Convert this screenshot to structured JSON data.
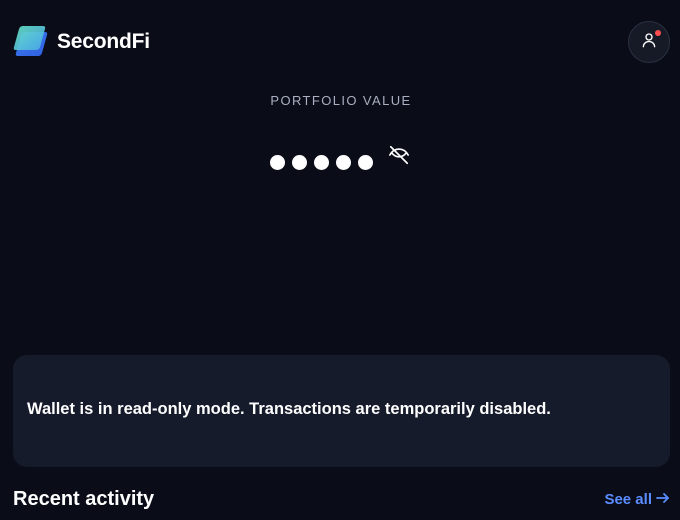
{
  "header": {
    "brand": "SecondFi",
    "logo_icon": "layers-logo-icon",
    "profile_icon": "user-icon",
    "has_notification": true
  },
  "portfolio": {
    "label": "PORTFOLIO VALUE",
    "masked_dots": 5,
    "visibility_icon": "eye-off-icon"
  },
  "banner": {
    "message": "Wallet is in read-only mode. Transactions are temporarily disabled."
  },
  "recent_activity": {
    "title": "Recent activity",
    "see_all_label": "See all",
    "see_all_icon": "arrow-right-icon"
  },
  "colors": {
    "background": "#0a0d18",
    "card": "#161b2b",
    "accent": "#5b8cff",
    "notification": "#ff4d4f",
    "logo_primary": "#3b82f6",
    "logo_secondary": "#5ee0c8"
  }
}
